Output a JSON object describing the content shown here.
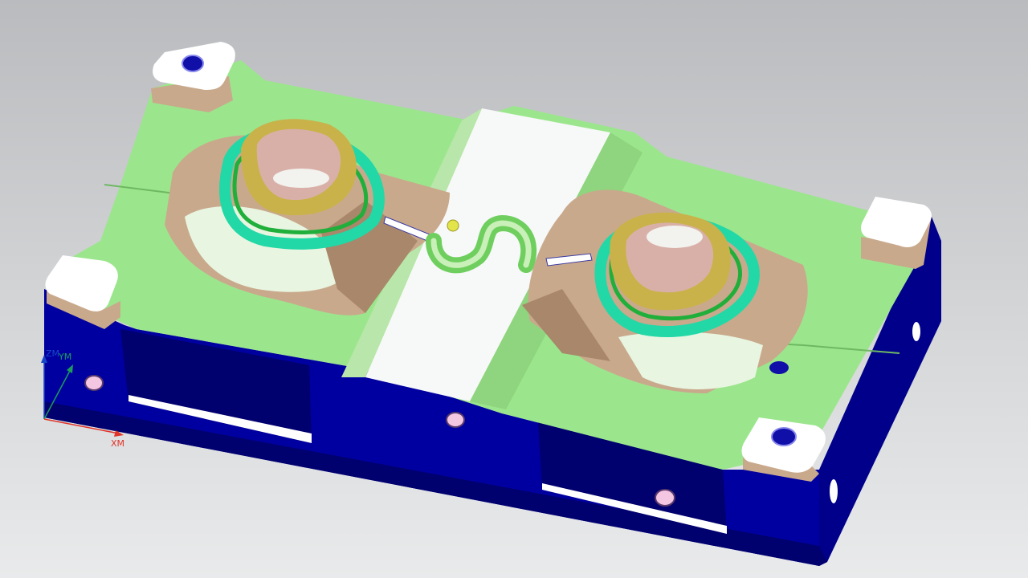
{
  "viewport": {
    "background_top": "#b9bbbe",
    "background_bottom": "#e9eaeb"
  },
  "model": {
    "colors": {
      "plate_side": "#0000a0",
      "plate_side_dark": "#00006e",
      "parting_surface": "#9be68c",
      "parting_surface_shade": "#7fd071",
      "cavity_wall": "#c9a98c",
      "cavity_wall_dark": "#a8876a",
      "insert_teal": "#22d8a6",
      "insert_green": "#1faf3a",
      "core_gold": "#c9b24a",
      "core_pink": "#d9b0a8",
      "runner_slot": "#ffffff",
      "locating_pad": "#ffffff",
      "bolt_hole": "#1010a8",
      "side_hole_pink": "#f3c6e2"
    }
  },
  "triad": {
    "x_label": "XM",
    "y_label": "YM",
    "z_label": "ZM",
    "x_color": "#e0342a",
    "y_color": "#1a9e5a",
    "z_color": "#1846c8"
  }
}
